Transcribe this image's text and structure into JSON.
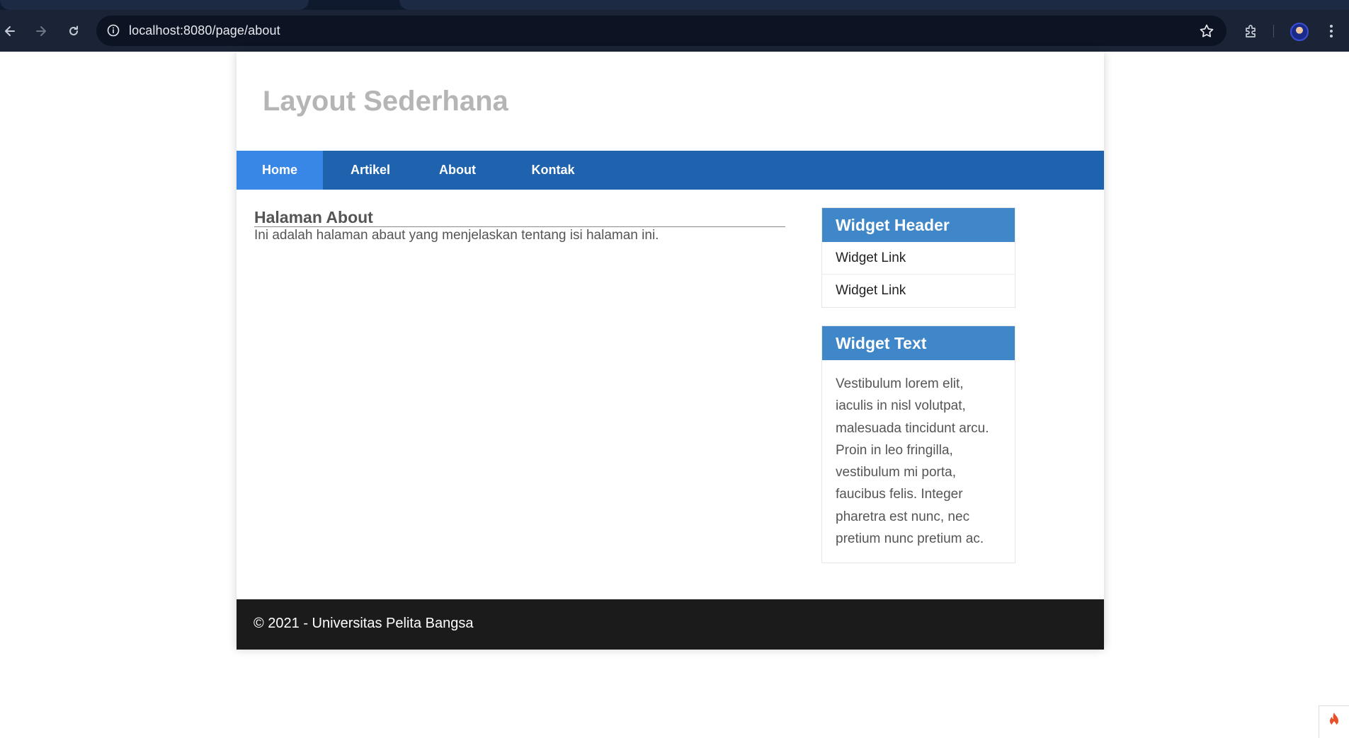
{
  "browser": {
    "url": "localhost:8080/page/about",
    "icons": {
      "back": "arrow-left-icon",
      "forward": "arrow-right-icon",
      "reload": "reload-icon",
      "site_info": "info-icon",
      "bookmark": "star-icon",
      "extensions": "puzzle-icon",
      "menu": "kebab-menu-icon"
    }
  },
  "site": {
    "title": "Layout Sederhana"
  },
  "nav": {
    "items": [
      {
        "label": "Home",
        "active": true
      },
      {
        "label": "Artikel",
        "active": false
      },
      {
        "label": "About",
        "active": false
      },
      {
        "label": "Kontak",
        "active": false
      }
    ]
  },
  "content": {
    "heading": "Halaman About",
    "body": "Ini adalah halaman abaut yang menjelaskan tentang isi halaman ini."
  },
  "sidebar": {
    "widget_header": {
      "title": "Widget Header",
      "links": [
        "Widget Link",
        "Widget Link"
      ]
    },
    "widget_text": {
      "title": "Widget Text",
      "body": "Vestibulum lorem elit, iaculis in nisl volutpat, malesuada tincidunt arcu. Proin in leo fringilla, vestibulum mi porta, faucibus felis. Integer pharetra est nunc, nec pretium nunc pretium ac."
    }
  },
  "footer": {
    "text": "© 2021 - Universitas Pelita Bangsa"
  },
  "colors": {
    "nav_bg": "#1f62ae",
    "nav_active": "#3887e6",
    "widget_header": "#3f87c8",
    "footer_bg": "#1b1b1b",
    "title": "#b5b5b5",
    "debug_toolbar_flame": "#e8502a"
  }
}
